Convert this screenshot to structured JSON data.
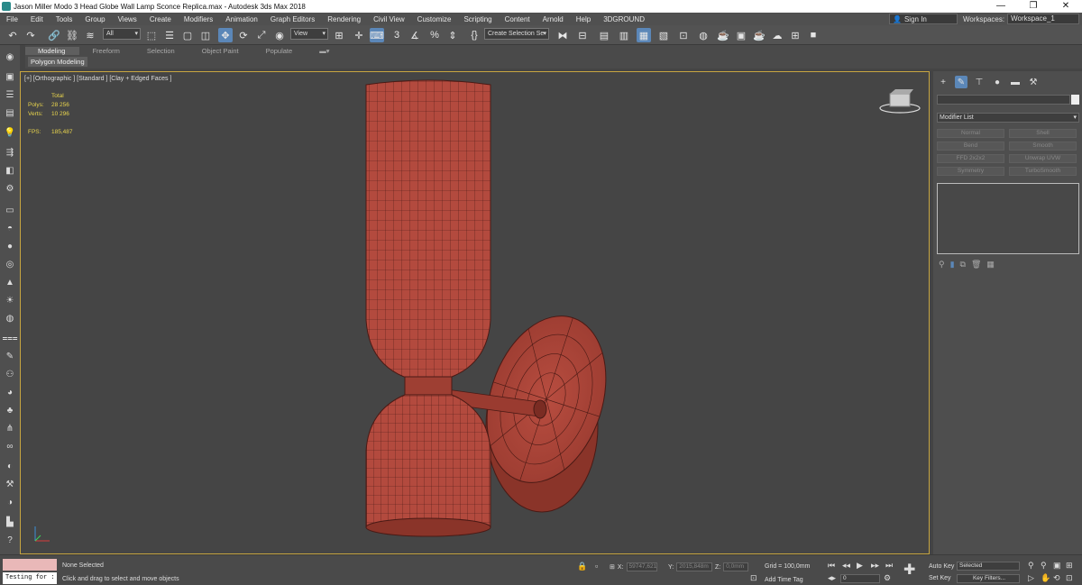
{
  "window": {
    "title": "Jason Miller Modo 3 Head Globe Wall Lamp Sconce Replica.max - Autodesk 3ds Max 2018",
    "controls": [
      "—",
      "❐",
      "✕"
    ]
  },
  "menu": {
    "items": [
      "File",
      "Edit",
      "Tools",
      "Group",
      "Views",
      "Create",
      "Modifiers",
      "Animation",
      "Graph Editors",
      "Rendering",
      "Civil View",
      "Customize",
      "Scripting",
      "Content",
      "Arnold",
      "Help",
      "3DGROUND"
    ],
    "sign_in": "Sign In",
    "workspaces_label": "Workspaces:",
    "workspace_value": "Workspace_1"
  },
  "toolbar": {
    "selection_filter": "All",
    "reference_coord": "View",
    "snap_label": "3",
    "named_selection": "Create Selection Se"
  },
  "ribbon": {
    "tabs": [
      "Modeling",
      "Freeform",
      "Selection",
      "Object Paint",
      "Populate"
    ],
    "sub_label": "Polygon Modeling"
  },
  "viewport": {
    "label": "[+] [Orthographic ] [Standard ] [Clay + Edged Faces ]",
    "stats": {
      "total_label": "Total",
      "polys_label": "Polys:",
      "polys_value": "28 256",
      "verts_label": "Verts:",
      "verts_value": "10 296",
      "fps_label": "FPS:",
      "fps_value": "185,487"
    },
    "colors": {
      "model": "#b34a3e",
      "wire": "#4a1a15",
      "border": "#c8a641"
    }
  },
  "command_panel": {
    "modifier_list": "Modifier List",
    "modifier_buttons": [
      "Normal",
      "Shell",
      "Bend",
      "Smooth",
      "FFD 2x2x2",
      "Unwrap UVW",
      "Symmetry",
      "TurboSmooth"
    ]
  },
  "status": {
    "maxscript_value": "Testing for :",
    "selection": "None Selected",
    "prompt": "Click and drag to select and move objects",
    "x_label": "X:",
    "x_value": "59747,621",
    "y_label": "Y:",
    "y_value": "2015,848m",
    "z_label": "Z:",
    "z_value": "0,0mm",
    "grid": "Grid = 100,0mm",
    "add_time_tag": "Add Time Tag",
    "auto_key": "Auto Key",
    "set_key": "Set Key",
    "key_mode": "Selected",
    "key_filters": "Key Filters...",
    "frame": "0"
  }
}
